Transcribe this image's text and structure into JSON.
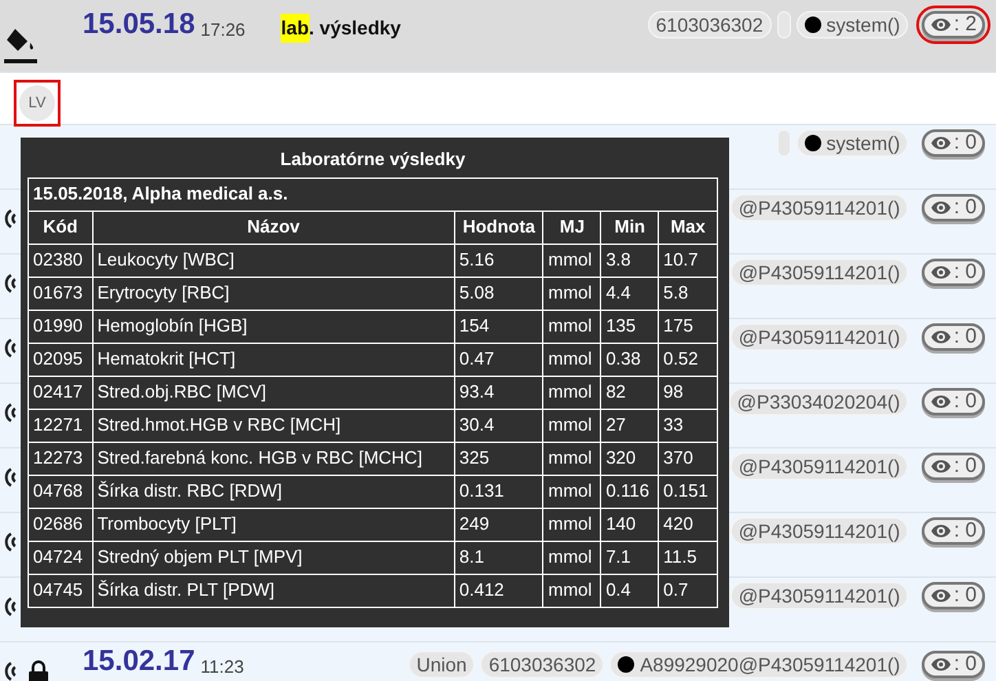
{
  "entries": [
    {
      "kind": "full",
      "icons": [
        {
          "kind": "bucket"
        }
      ],
      "date": "15.05.18",
      "time": "17:26",
      "tag": "lab",
      "title": ". výsledky",
      "chips": [
        {
          "kind": "text",
          "text": "6103036302"
        },
        {
          "kind": "blank"
        },
        {
          "kind": "user",
          "text": "system()"
        }
      ],
      "views": ": 2",
      "highlighted": true
    },
    {
      "kind": "avatar",
      "initials": "LV",
      "highlighted": true
    },
    {
      "kind": "partial",
      "chips": [
        {
          "kind": "blank"
        },
        {
          "kind": "user",
          "text": "system()"
        }
      ],
      "views": ": 0",
      "highlighted": false
    },
    {
      "kind": "partial",
      "icons": [
        {
          "kind": "signal"
        }
      ],
      "chips": [
        {
          "kind": "text",
          "text": "@P43059114201()"
        }
      ],
      "views": ": 0",
      "highlighted": false
    },
    {
      "kind": "partial",
      "icons": [
        {
          "kind": "signal"
        }
      ],
      "chips": [
        {
          "kind": "text",
          "text": "@P43059114201()"
        }
      ],
      "views": ": 0",
      "highlighted": false
    },
    {
      "kind": "partial",
      "icons": [
        {
          "kind": "signal"
        }
      ],
      "chips": [
        {
          "kind": "text",
          "text": "@P43059114201()"
        }
      ],
      "views": ": 0",
      "highlighted": false
    },
    {
      "kind": "partial",
      "icons": [
        {
          "kind": "signal"
        }
      ],
      "chips": [
        {
          "kind": "text",
          "text": "@P33034020204()"
        }
      ],
      "views": ": 0",
      "highlighted": false
    },
    {
      "kind": "partial",
      "icons": [
        {
          "kind": "signal"
        }
      ],
      "chips": [
        {
          "kind": "text",
          "text": "@P43059114201()"
        }
      ],
      "views": ": 0",
      "highlighted": false
    },
    {
      "kind": "partial",
      "icons": [
        {
          "kind": "signal"
        }
      ],
      "chips": [
        {
          "kind": "text",
          "text": "@P43059114201()"
        }
      ],
      "views": ": 0",
      "highlighted": false
    },
    {
      "kind": "partial",
      "icons": [
        {
          "kind": "signal"
        }
      ],
      "chips": [
        {
          "kind": "text",
          "text": "@P43059114201()"
        }
      ],
      "views": ": 0",
      "highlighted": false
    },
    {
      "kind": "full",
      "icons": [
        {
          "kind": "signal"
        },
        {
          "kind": "lock"
        }
      ],
      "date": "15.02.17",
      "time": "11:23",
      "chips": [
        {
          "kind": "text",
          "text": "Union"
        },
        {
          "kind": "text",
          "text": "6103036302"
        },
        {
          "kind": "user",
          "text": "A89929020@P43059114201()"
        }
      ],
      "views": ": 0",
      "highlighted": false
    }
  ],
  "popup": {
    "title": "Laboratórne výsledky",
    "subtitle": "15.05.2018, Alpha medical a.s.",
    "columns": [
      "Kód",
      "Názov",
      "Hodnota",
      "MJ",
      "Min",
      "Max"
    ],
    "rows": [
      [
        "02380",
        "Leukocyty [WBC]",
        "5.16",
        "mmol",
        "3.8",
        "10.7"
      ],
      [
        "01673",
        "Erytrocyty [RBC]",
        "5.08",
        "mmol",
        "4.4",
        "5.8"
      ],
      [
        "01990",
        "Hemoglobín [HGB]",
        "154",
        "mmol",
        "135",
        "175"
      ],
      [
        "02095",
        "Hematokrit [HCT]",
        "0.47",
        "mmol",
        "0.38",
        "0.52"
      ],
      [
        "02417",
        "Stred.obj.RBC [MCV]",
        "93.4",
        "mmol",
        "82",
        "98"
      ],
      [
        "12271",
        "Stred.hmot.HGB v RBC [MCH]",
        "30.4",
        "mmol",
        "27",
        "33"
      ],
      [
        "12273",
        "Stred.farebná konc. HGB v RBC [MCHC]",
        "325",
        "mmol",
        "320",
        "370"
      ],
      [
        "04768",
        "Šírka distr. RBC [RDW]",
        "0.131",
        "mmol",
        "0.116",
        "0.151"
      ],
      [
        "02686",
        "Trombocyty [PLT]",
        "249",
        "mmol",
        "140",
        "420"
      ],
      [
        "04724",
        "Stredný objem PLT [MPV]",
        "8.1",
        "mmol",
        "7.1",
        "11.5"
      ],
      [
        "04745",
        "Šírka distr. PLT [PDW]",
        "0.412",
        "mmol",
        "0.4",
        "0.7"
      ]
    ]
  }
}
